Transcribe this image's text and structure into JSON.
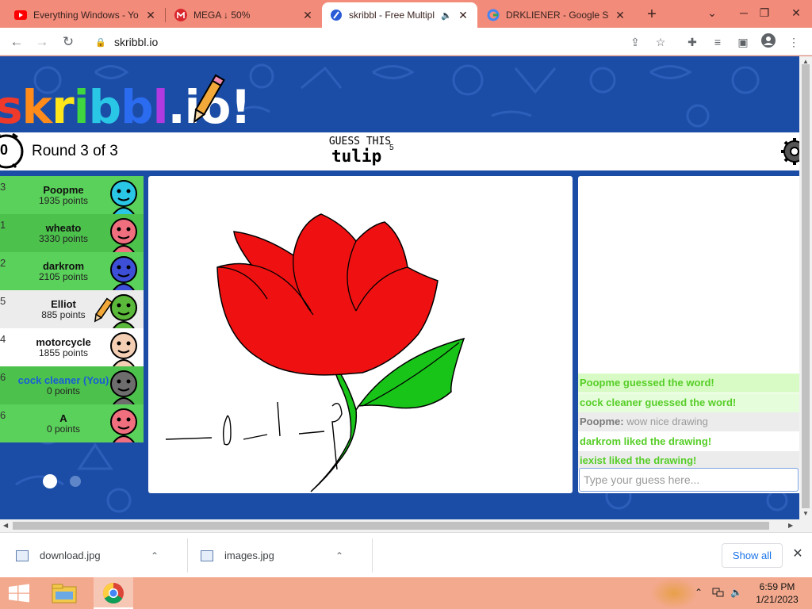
{
  "browser": {
    "tabs": [
      {
        "title": "Everything Windows - Yo",
        "favicon": "youtube-icon",
        "favicon_color": "#ff0000"
      },
      {
        "title": "MEGA ↓ 50%",
        "favicon": "mega-icon",
        "favicon_color": "#d9272e"
      },
      {
        "title": "skribbl - Free Multipl",
        "favicon": "skribbl-icon",
        "favicon_color": "#2a5bd7"
      },
      {
        "title": "DRKLIENER - Google Sea",
        "favicon": "google-icon",
        "favicon_color": "#4285f4"
      }
    ],
    "active_tab": 2,
    "new_tab_symbol": "+",
    "url": "skribbl.io"
  },
  "game": {
    "logo": "skribbl.io",
    "clock_value": "0",
    "round_text": "Round 3 of 3",
    "guess_label": "GUESS THIS",
    "word": "tulip",
    "word_letter_count": "5",
    "players": [
      {
        "rank": "3",
        "name": "Poopme",
        "points": "1935 points",
        "bg": "#5ad15a",
        "avatar_color": "#29c6e6",
        "drawing": false,
        "you": false
      },
      {
        "rank": "1",
        "name": "wheato",
        "points": "3330 points",
        "bg": "#4cc24c",
        "avatar_color": "#ef6f7f",
        "drawing": false,
        "you": false
      },
      {
        "rank": "2",
        "name": "darkrom",
        "points": "2105 points",
        "bg": "#5ad15a",
        "avatar_color": "#3d4fd6",
        "drawing": false,
        "you": false
      },
      {
        "rank": "5",
        "name": "Elliot",
        "points": "885 points",
        "bg": "#ececec",
        "avatar_color": "#5ab83a",
        "drawing": true,
        "you": false
      },
      {
        "rank": "4",
        "name": "motorcycle",
        "points": "1855 points",
        "bg": "#ffffff",
        "avatar_color": "#f4cfb4",
        "drawing": false,
        "you": false
      },
      {
        "rank": "6",
        "name": "cock cleaner (You)",
        "points": "0 points",
        "bg": "#4cc24c",
        "avatar_color": "#6d6d6d",
        "drawing": false,
        "you": true
      },
      {
        "rank": "6",
        "name": "A",
        "points": "0 points",
        "bg": "#5ad15a",
        "avatar_color": "#ef6f7f",
        "drawing": false,
        "you": false
      }
    ],
    "chat": [
      {
        "name": "Poopme guessed the word!",
        "text": "",
        "bg": "#d8fbc6",
        "color": "#56ce27"
      },
      {
        "name": "cock cleaner guessed the word!",
        "text": "",
        "bg": "#e6fddc",
        "color": "#56ce27"
      },
      {
        "name": "Poopme:",
        "text": " wow nice drawing",
        "bg": "#ececec",
        "color": "#7a7a7a"
      },
      {
        "name": "darkrom liked the drawing!",
        "text": "",
        "bg": "#ffffff",
        "color": "#56ce27"
      },
      {
        "name": "iexist liked the drawing!",
        "text": "",
        "bg": "#ececec",
        "color": "#56ce27"
      }
    ],
    "input_placeholder": "Type your guess here...",
    "colors": {
      "background": "#1c4da6",
      "flower_red": "#ef1111",
      "leaf_green": "#19c419"
    }
  },
  "downloads": {
    "items": [
      {
        "name": "download.jpg"
      },
      {
        "name": "images.jpg"
      }
    ],
    "show_all": "Show all"
  },
  "taskbar": {
    "time": "6:59 PM",
    "date": "1/21/2023"
  }
}
